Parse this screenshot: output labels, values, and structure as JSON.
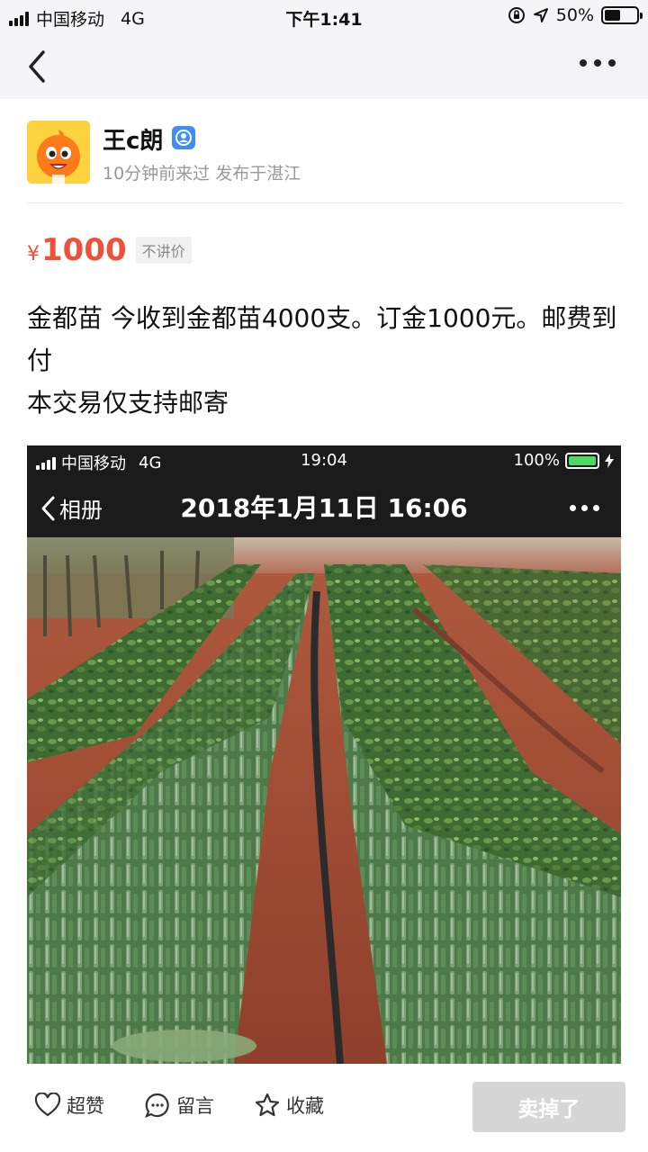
{
  "status_bar": {
    "carrier": "中国移动",
    "network": "4G",
    "time": "下午1:41",
    "battery": "50%"
  },
  "author": {
    "name": "王c朗",
    "meta": "10分钟前来过  发布于湛江"
  },
  "listing": {
    "currency": "¥",
    "price": "1000",
    "negotiable_tag": "不讲价",
    "description_line1": "金都苗 今收到金都苗4000支。订金1000元。邮费到付",
    "description_line2": "本交易仅支持邮寄"
  },
  "photo": {
    "status": {
      "carrier": "中国移动",
      "network": "4G",
      "time": "19:04",
      "battery": "100%"
    },
    "nav": {
      "back_label": "相册",
      "title": "2018年1月11日 16:06"
    }
  },
  "bottom_bar": {
    "like_label": "超赞",
    "comment_label": "留言",
    "favorite_label": "收藏",
    "sold_label": "卖掉了"
  },
  "colors": {
    "price": "#f0503b",
    "bar_bg": "#f5f5f7",
    "sold_button": "#d6d6d6",
    "verified_badge": "#3f8ef4"
  },
  "icons": [
    "back-icon",
    "more-icon",
    "verified-icon",
    "heart-icon",
    "comment-icon",
    "star-icon"
  ]
}
